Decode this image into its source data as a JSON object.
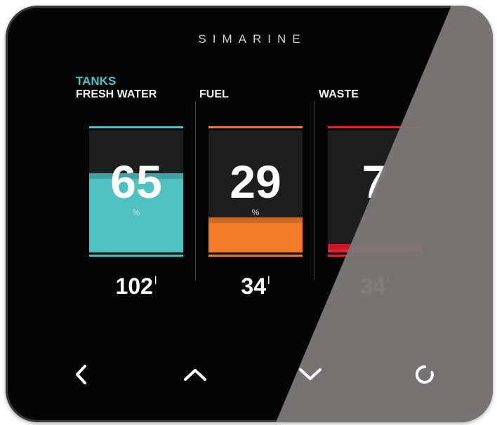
{
  "brand": "SIMARINE",
  "section_title": "TANKS",
  "tanks": [
    {
      "label": "FRESH WATER",
      "percent": "65",
      "level": 0.65,
      "percent_sign": "%",
      "volume": "102",
      "unit": "l",
      "color": "#4fc1c1"
    },
    {
      "label": "FUEL",
      "percent": "29",
      "level": 0.29,
      "percent_sign": "%",
      "volume": "34",
      "unit": "l",
      "color": "#f07c2a"
    },
    {
      "label": "WASTE",
      "percent": "7",
      "level": 0.07,
      "percent_sign": "%",
      "volume": "34",
      "unit": "l",
      "color": "#e8222e"
    }
  ],
  "nav": {
    "back_icon": "chevron-left-icon",
    "up_icon": "chevron-up-icon",
    "down_icon": "chevron-down-icon",
    "select_icon": "circle-icon"
  }
}
